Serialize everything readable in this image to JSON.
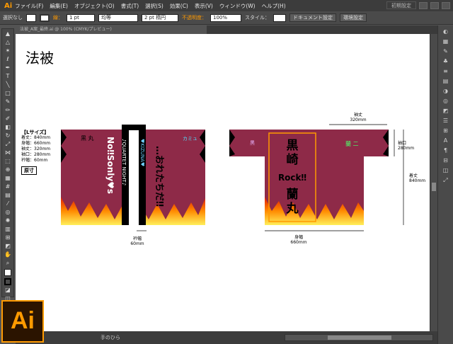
{
  "app": {
    "logo": "Ai"
  },
  "menu": [
    "ファイル(F)",
    "編集(E)",
    "オブジェクト(O)",
    "書式(T)",
    "選択(S)",
    "効果(C)",
    "表示(V)",
    "ウィンドウ(W)",
    "ヘルプ(H)"
  ],
  "workspace": "初期設定",
  "control": {
    "selection": "選択なし",
    "stroke_label": "線：",
    "stroke_value": "1 pt",
    "profile": "均等",
    "brush": "2 pt 楕円",
    "opacity_label": "不透明度：",
    "opacity_value": "100%",
    "style_label": "スタイル：",
    "doc_settings": "ドキュメント設定",
    "env_settings": "環境設定"
  },
  "document_tab": "法被_A案_最終.ai @ 100% (CMYK/プレビュー)",
  "status": {
    "tool": "手のひら"
  },
  "artboard": {
    "title": "法被",
    "spec": {
      "heading": "【Lサイズ】",
      "lines": [
        "着丈：840mm",
        "身幅：660mm",
        "袖丈：320mm",
        "袖口：280mm",
        "衿幅：60mm"
      ],
      "scale": "原寸"
    },
    "front": {
      "sleeve_left": "黒 丸",
      "text_left": "No‼Sonly♥s",
      "collar_text": "♪QUARTET NIGHT♪",
      "collar_right": "♥KIZUNA♥",
      "text_right": "…おれたちだ‼",
      "sleeve_right": "カミュ",
      "collar_dim_label": "衿幅",
      "collar_dim_value": "60mm"
    },
    "back": {
      "sleeve_left": "黒",
      "line1": "黒",
      "line2": "崎",
      "line3": "Rock‼",
      "line4": "蘭",
      "line5": "丸",
      "sleeve_right": "蘭 二",
      "sleeve_length_label": "袖丈",
      "sleeve_length_value": "320mm",
      "cuff_label": "袖口",
      "cuff_value": "280mm",
      "length_label": "着丈",
      "length_value": "840mm",
      "width_label": "身幅",
      "width_value": "660mm"
    }
  }
}
